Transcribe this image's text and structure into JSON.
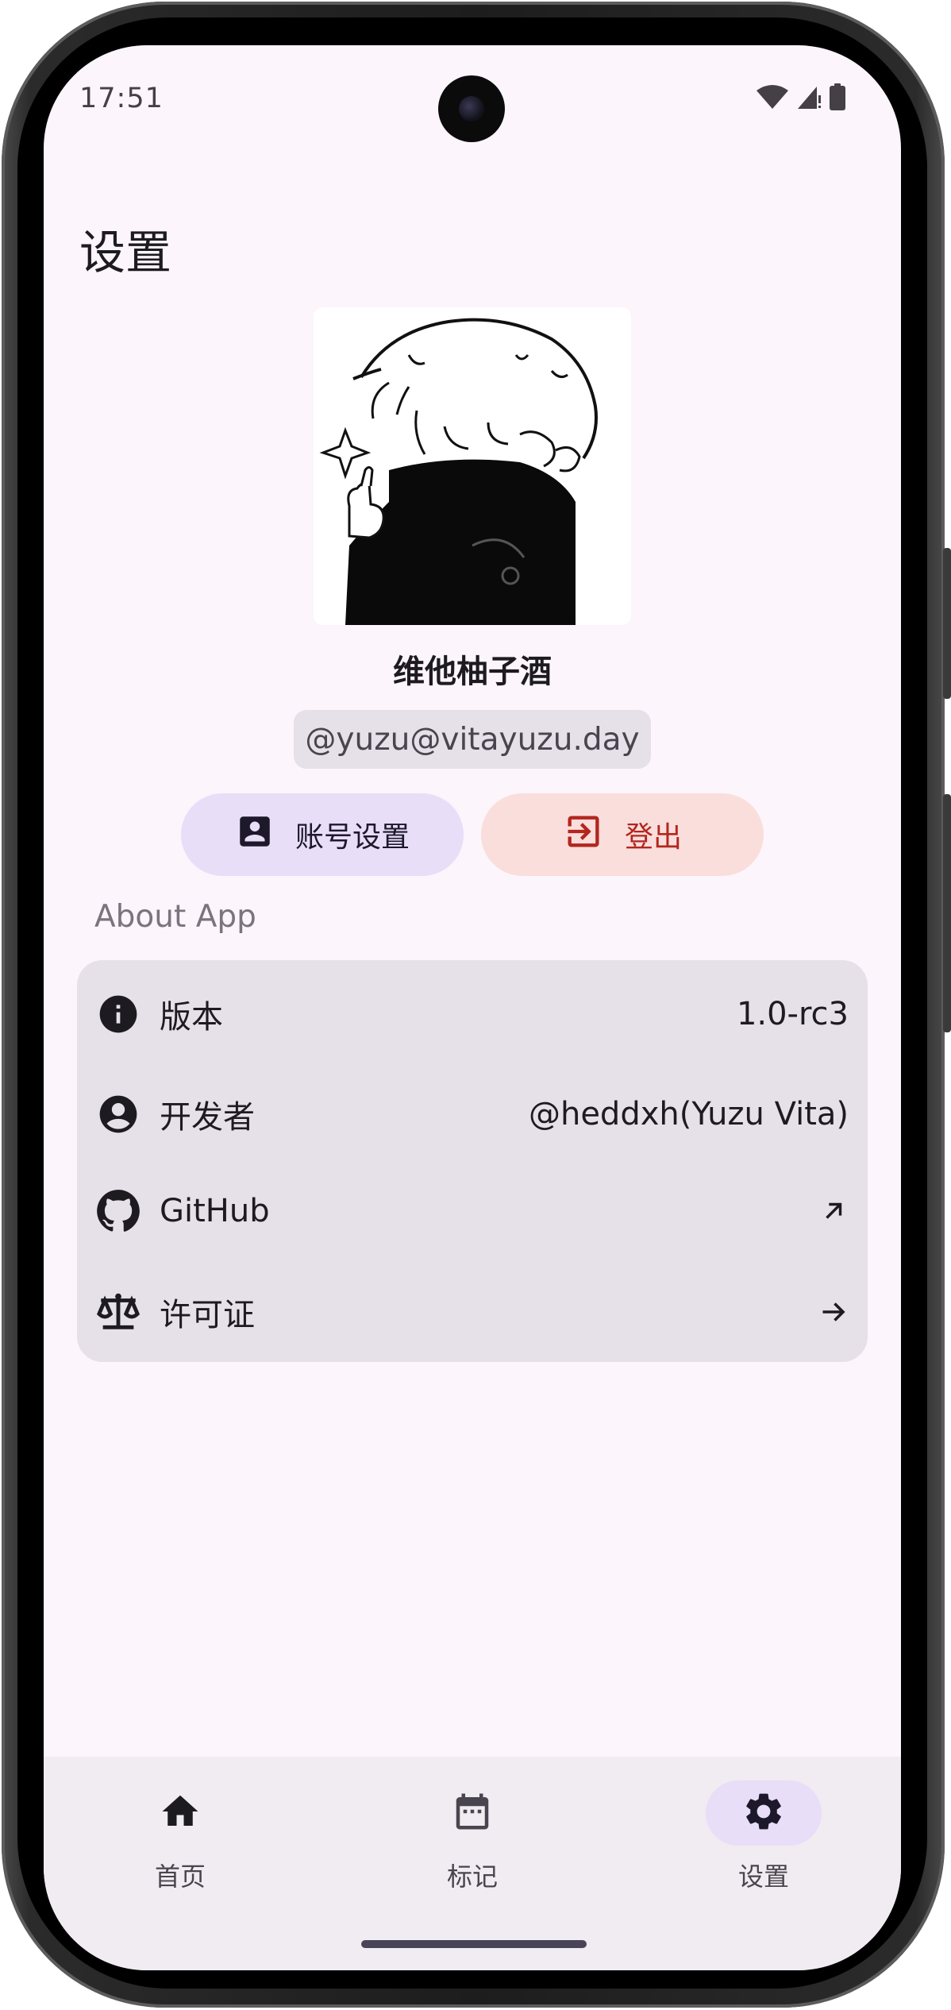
{
  "status_bar": {
    "time": "17:51",
    "icons": [
      "wifi-icon",
      "cellular-signal-icon",
      "battery-icon"
    ]
  },
  "page": {
    "title": "设置"
  },
  "profile": {
    "display_name": "维他柚子酒",
    "handle": "@yuzu@vitayuzu.day",
    "avatar": "avatar-illustration"
  },
  "actions": {
    "account_settings_label": "账号设置",
    "logout_label": "登出"
  },
  "about": {
    "section_label": "About App",
    "items": [
      {
        "label": "版本",
        "value": "1.0-rc3",
        "icon": "info-icon"
      },
      {
        "label": "开发者",
        "value": "@heddxh(Yuzu Vita)",
        "icon": "account-circle-icon"
      },
      {
        "label": "GitHub",
        "value": "",
        "icon": "github-icon",
        "trailing": "open-in-new-arrow-icon"
      },
      {
        "label": "许可证",
        "value": "",
        "icon": "balance-scale-icon",
        "trailing": "arrow-forward-icon"
      }
    ]
  },
  "bottom_nav": {
    "items": [
      {
        "label": "首页",
        "icon": "home-icon",
        "selected": false
      },
      {
        "label": "标记",
        "icon": "calendar-icon",
        "selected": false
      },
      {
        "label": "设置",
        "icon": "settings-gear-icon",
        "selected": true
      }
    ]
  },
  "colors": {
    "background": "#fcf5fc",
    "primary_container": "#e8def8",
    "error_container": "#f9dedc",
    "error": "#b3261e",
    "surface_variant": "#e6e0e8",
    "nav_background": "#f1ebf2"
  }
}
